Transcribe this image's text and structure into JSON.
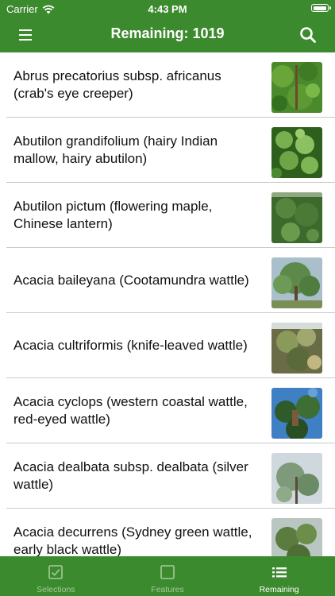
{
  "status_bar": {
    "carrier": "Carrier",
    "time": "4:43 PM"
  },
  "nav": {
    "title": "Remaining: 1019"
  },
  "items": [
    {
      "name": "Abrus precatorius subsp. africanus (crab's eye creeper)"
    },
    {
      "name": "Abutilon grandifolium (hairy Indian mallow, hairy abutilon)"
    },
    {
      "name": "Abutilon pictum (flowering maple, Chinese lantern)"
    },
    {
      "name": "Acacia baileyana (Cootamundra wattle)"
    },
    {
      "name": "Acacia cultriformis (knife-leaved wattle)"
    },
    {
      "name": "Acacia cyclops (western coastal wattle, red-eyed wattle)"
    },
    {
      "name": "Acacia dealbata subsp. dealbata (silver wattle)"
    },
    {
      "name": "Acacia decurrens (Sydney green wattle, early black wattle)"
    }
  ],
  "tabs": [
    {
      "label": "Selections"
    },
    {
      "label": "Features"
    },
    {
      "label": "Remaining"
    }
  ],
  "colors": {
    "primary_green": "#3c8a2e",
    "inactive_tab": "#a5cc9a",
    "separator": "#c9c9c9"
  }
}
